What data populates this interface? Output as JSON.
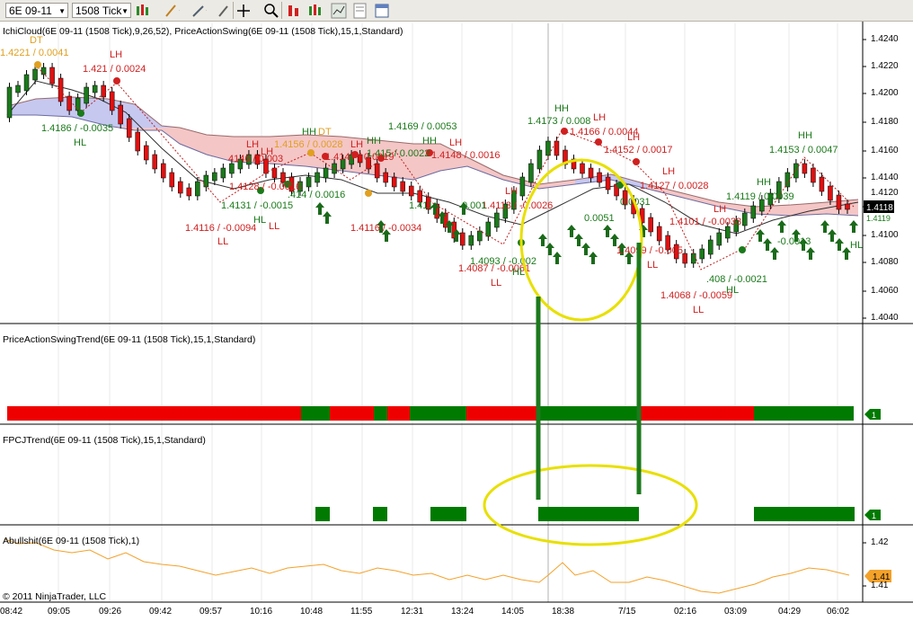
{
  "toolbar": {
    "instrument": "6E 09-11",
    "period": "1508 Tick"
  },
  "panels": {
    "price_title": "IchiCloud(6E 09-11 (1508 Tick),9,26,52), PriceActionSwing(6E 09-11 (1508 Tick),15,1,Standard)",
    "trend_title": "PriceActionSwingTrend(6E 09-11 (1508 Tick),15,1,Standard)",
    "fpcj_title": "FPCJTrend(6E 09-11 (1508 Tick),15,1,Standard)",
    "abull_title": "Abullshit(6E 09-11 (1508 Tick),1)",
    "copyright": "© 2011 NinjaTrader, LLC"
  },
  "price_axis": [
    "1.4240",
    "1.4220",
    "1.4200",
    "1.4180",
    "1.4160",
    "1.4140",
    "1.4120",
    "1.4100",
    "1.4080",
    "1.4060",
    "1.4040"
  ],
  "current_price": "1.4118",
  "current_price_small": "1.4119",
  "trend_marker": "1",
  "fpcj_marker": "1",
  "abull_axis": [
    "1.42",
    "1.41"
  ],
  "abull_value": "1.41",
  "time_axis": [
    "08:42",
    "09:05",
    "09:26",
    "09:42",
    "09:57",
    "10:16",
    "10:48",
    "11:55",
    "12:31",
    "13:24",
    "14:05",
    "18:38",
    "7/15",
    "02:16",
    "03:09",
    "04:29",
    "06:02"
  ],
  "swing_labels": {
    "dt1": "DT",
    "dt1_val": "1.4221 / 0.0041",
    "lh1": "LH",
    "lh1_val": "1.421 / 0.0024",
    "hl1_val": "1.4186 / -0.0035",
    "hl1": "HL",
    "hh1": "HH",
    "dt2": "DT",
    "v1": "1.4156 / 0.0028",
    "lh2": "LH",
    "lh3": "LH",
    "v2": "4146 / 0.003",
    "v3": "1.4169 / 0.0053",
    "hh2": "HH",
    "hh3": "HH",
    "lh4": "LH",
    "v4": "1.4147 / 0.0019",
    "v5": "1.415 / 0.0022",
    "v6": "1.4148 / 0.0016",
    "v7": "1.4128 / -0.0016",
    "v8": "1.4131 / -0.0015",
    "v9": ".414 / 0.0016",
    "v10": "1.4116 / -0.0094",
    "ll1": "LL",
    "ll2": "LL",
    "hl2": "HL",
    "v11": "1.4116 / -0.0034",
    "v12": "1.4113 / -0.0026",
    "v13": "1.411",
    "v14": "0.001",
    "lh5": "LH",
    "v15": "1.4093 / -0.002",
    "v16": "1.4087 / -0.0061",
    "ll3": "LL",
    "hl3": "HL",
    "hh4": "HH",
    "v17": "1.4173 / 0.008",
    "lh6": "LH",
    "v18": "1.4166 / 0.0044",
    "lh7": "LH",
    "v19": "1.4152 / 0.0017",
    "v20": "0.0051",
    "v21": "0.0031",
    "v22": "1.4099 / -0.005",
    "ll4": "LL",
    "lh8": "LH",
    "v23": "1.4127 / 0.0028",
    "lh9": "LH",
    "v24": "1.4101 / -0.0033",
    "v25": ".408 / -0.0021",
    "hl4": "HL",
    "v26": "1.4068 / -0.0059",
    "ll5": "LL",
    "hh5": "HH",
    "v27": "1.4153 / 0.0047",
    "hh6": "HH",
    "v28": "1.4119 / 0.0039",
    "v29": "-0.0013",
    "hl5": "HL"
  },
  "colors": {
    "bull": "#1a7a1a",
    "bear": "#e01010",
    "trend_green": "#007a00",
    "trend_red": "#ee0000",
    "cloud_red": "#f4c6c6",
    "cloud_blue": "#c6c8f0",
    "annotation": "#e8e000",
    "abull_line": "#f3a12a"
  }
}
